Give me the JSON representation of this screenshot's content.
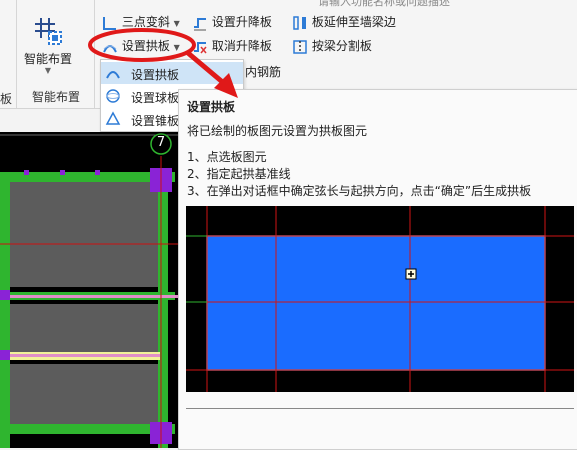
{
  "ribbon": {
    "search_hint": "请输入功能名称或问题描述",
    "left_edge_caption": "板",
    "smart_layout_button": "智能布置",
    "smart_layout_group": "智能布置",
    "three_point_slope": "三点变斜",
    "set_arch_slab": "设置拱板",
    "set_lift_slab": "设置升降板",
    "cancel_lift_slab": "取消升降板",
    "extend_slab_to_wall_beam": "板延伸至墙梁边",
    "split_by_beam": "按梁分割板",
    "inner_rebar_fragment": "内钢筋"
  },
  "dropdown": {
    "items": [
      {
        "label": "设置拱板",
        "selected": true
      },
      {
        "label": "设置球板",
        "selected": false
      },
      {
        "label": "设置锥板",
        "selected": false
      }
    ]
  },
  "canvas": {
    "axis_label": "7"
  },
  "tooltip": {
    "title": "设置拱板",
    "description": "将已绘制的板图元设置为拱板图元",
    "steps": [
      "1、点选板图元",
      "2、指定起拱基准线",
      "3、在弹出对话框中确定弦长与起拱方向，点击“确定”后生成拱板"
    ]
  },
  "colors": {
    "accent_red": "#e01919",
    "slab_blue": "#1a6cff",
    "beam_green": "#2fb52f",
    "column_purple": "#8a23d6",
    "selected_menu": "#cfe4f7"
  }
}
